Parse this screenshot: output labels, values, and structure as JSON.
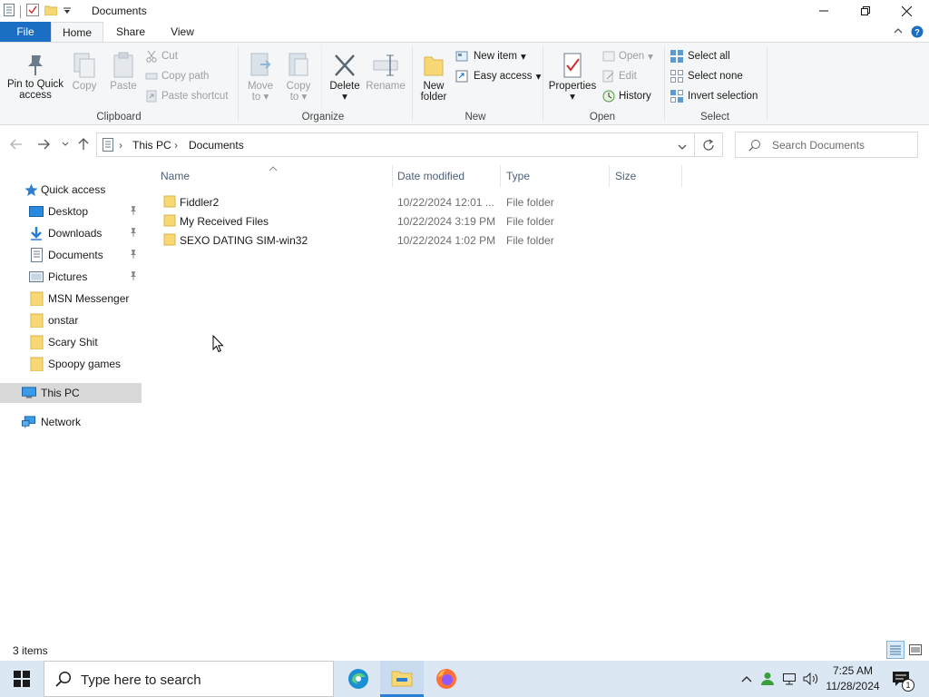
{
  "window": {
    "title": "Documents",
    "minimize_glyph": "—",
    "restore_glyph": "❐",
    "close_glyph": "✕"
  },
  "ribbon_tabs": {
    "file": "File",
    "home": "Home",
    "share": "Share",
    "view": "View"
  },
  "clipboard": {
    "pin": "Pin to Quick access",
    "pin_line1": "Pin to Quick",
    "pin_line2": "access",
    "copy": "Copy",
    "paste": "Paste",
    "cut": "Cut",
    "copy_path": "Copy path",
    "paste_shortcut": "Paste shortcut",
    "group_label": "Clipboard"
  },
  "organize": {
    "move_to_line1": "Move",
    "move_to_line2": "to",
    "copy_to_line1": "Copy",
    "copy_to_line2": "to",
    "delete": "Delete",
    "rename": "Rename",
    "group_label": "Organize"
  },
  "new_group": {
    "new_folder_line1": "New",
    "new_folder_line2": "folder",
    "new_item": "New item",
    "easy_access": "Easy access",
    "group_label": "New"
  },
  "open_group": {
    "properties": "Properties",
    "open": "Open",
    "edit": "Edit",
    "history": "History",
    "group_label": "Open"
  },
  "select_group": {
    "select_all": "Select all",
    "select_none": "Select none",
    "invert_selection": "Invert selection",
    "group_label": "Select"
  },
  "address": {
    "segments": [
      "This PC",
      "Documents"
    ],
    "separator": "›",
    "search_placeholder": "Search Documents"
  },
  "columns": {
    "name": "Name",
    "date_modified": "Date modified",
    "type": "Type",
    "size": "Size"
  },
  "files": [
    {
      "name": "Fiddler2",
      "date": "10/22/2024 12:01 ...",
      "type": "File folder",
      "size": ""
    },
    {
      "name": "My Received Files",
      "date": "10/22/2024 3:19 PM",
      "type": "File folder",
      "size": ""
    },
    {
      "name": "SEXO DATING SIM-win32",
      "date": "10/22/2024 1:02 PM",
      "type": "File folder",
      "size": ""
    }
  ],
  "nav_pane": {
    "quick_access": "Quick access",
    "items": [
      {
        "label": "Desktop",
        "pinned": true
      },
      {
        "label": "Downloads",
        "pinned": true
      },
      {
        "label": "Documents",
        "pinned": true
      },
      {
        "label": "Pictures",
        "pinned": true
      },
      {
        "label": "MSN Messenger",
        "pinned": false
      },
      {
        "label": "onstar",
        "pinned": false
      },
      {
        "label": "Scary Shit",
        "pinned": false
      },
      {
        "label": "Spoopy games",
        "pinned": false
      }
    ],
    "this_pc": "This PC",
    "network": "Network"
  },
  "status_bar": {
    "item_count": "3 items"
  },
  "taskbar": {
    "search_text": "Type here to search",
    "time": "7:25 AM",
    "date": "11/28/2024",
    "notification_count": "1"
  },
  "colors": {
    "accent": "#1a6fc4",
    "folder": "#f8d775",
    "taskbar": "#dbe7f3"
  }
}
